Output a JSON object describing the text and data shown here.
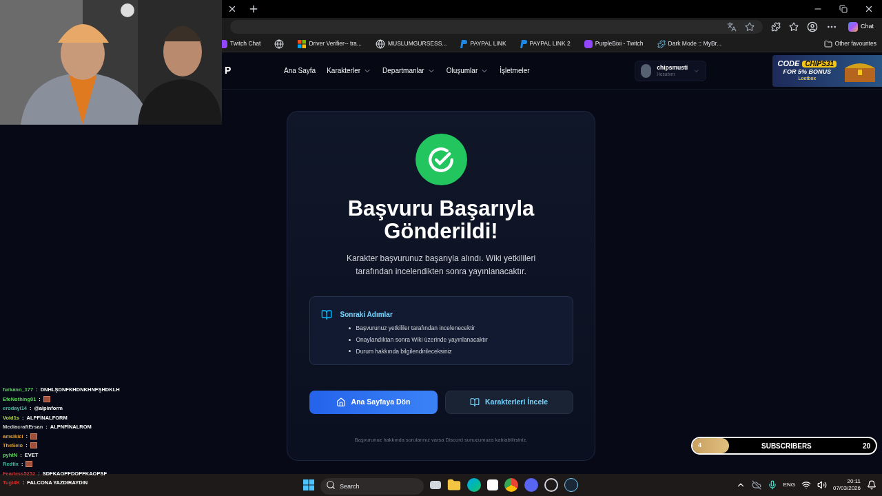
{
  "browser": {
    "chat_button": "Chat",
    "bookmarks": [
      {
        "kind": "labeled",
        "label": "Twitch Chat"
      },
      {
        "kind": "icon_only"
      },
      {
        "kind": "labeled",
        "label": "Driver Verifier-- tra..."
      },
      {
        "kind": "labeled",
        "label": "MUSLUMGURSESS..."
      },
      {
        "kind": "labeled",
        "label": "PAYPAL LINK"
      },
      {
        "kind": "labeled",
        "label": "PAYPAL LINK 2"
      },
      {
        "kind": "labeled",
        "label": "PurpleBixi - Twitch"
      },
      {
        "kind": "labeled",
        "label": "Dark Mode :: MyBr..."
      }
    ],
    "other_favourites": "Other favourites"
  },
  "site": {
    "logo": "P",
    "nav": [
      {
        "label": "Ana Sayfa",
        "dropdown": false
      },
      {
        "label": "Karakterler",
        "dropdown": true
      },
      {
        "label": "Departmanlar",
        "dropdown": true
      },
      {
        "label": "Oluşumlar",
        "dropdown": true
      },
      {
        "label": "İşletmeler",
        "dropdown": false
      }
    ],
    "user": {
      "name": "chipsmusti",
      "subtitle": "Hesabım"
    },
    "ad": {
      "code": "CODE",
      "promo": "CHIPS31",
      "bonus": "FOR 5% BONUS",
      "brand": "Lootbox"
    }
  },
  "card": {
    "title": "Başvuru Başarıyla Gönderildi!",
    "message": "Karakter başvurunuz başarıyla alındı. Wiki yetkilileri tarafından incelendikten sonra yayınlanacaktır.",
    "next_steps": {
      "title": "Sonraki Adımlar",
      "items": [
        "Başvurunuz yetkililer tarafından incelenecektir",
        "Onaylandıktan sonra Wiki üzerinde yayınlanacaktır",
        "Durum hakkında bilgilendirileceksiniz"
      ]
    },
    "buttons": [
      {
        "label": "Ana Sayfaya Dön",
        "kind": "primary"
      },
      {
        "label": "Karakterleri İncele",
        "kind": "secondary"
      }
    ],
    "footer": "Başvurunuz hakkında sorularınız varsa Discord sunucumuza katılabilirsiniz."
  },
  "chat": [
    {
      "user": "furkann_177",
      "sep": ":",
      "color": "#5fd35f",
      "message": "DNHLŞDNFKHDNKHNFŞHDKLH",
      "emote": false
    },
    {
      "user": "EfeNothing01",
      "sep": ":",
      "color": "#5fd35f",
      "emote": true
    },
    {
      "user": "erodayi14",
      "sep": ":",
      "color": "#3fbfa0",
      "message": "@alpinform",
      "emote": false
    },
    {
      "user": "Void1s",
      "sep": ":",
      "color": "#b5d94a",
      "message": "ALPFİNALFORM",
      "emote": false
    },
    {
      "user": "MediacraftErsan",
      "sep": ":",
      "color": "#d0d0d0",
      "message": "ALPNFİNALROM",
      "emote": false
    },
    {
      "user": "amsikici",
      "sep": ":",
      "color": "#e0a030",
      "emote": true
    },
    {
      "user": "TheSelo",
      "sep": ":",
      "color": "#e0a030",
      "emote": true
    },
    {
      "user": "pyhtN",
      "sep": ":",
      "color": "#5fd35f",
      "message": "EVET",
      "emote": false
    },
    {
      "user": "Redtix",
      "sep": ":",
      "color": "#3fbfa0",
      "emote": true
    },
    {
      "user": "Fearless5252",
      "sep": ":",
      "color": "#d03030",
      "message": "SDFKAOPFDOPFKAOPSF",
      "emote": false
    },
    {
      "user": "Tugi4K",
      "sep": ":",
      "color": "#d03030",
      "message": "FALCONA YAZDIRAYDIN",
      "emote": false
    }
  ],
  "subscribers": {
    "current": "4",
    "label": "SUBSCRIBERS",
    "goal": "20",
    "level": 0.2
  },
  "taskbar": {
    "search_placeholder": "Search",
    "language": "ENG",
    "time": "20:11",
    "date": "07/03/2026"
  }
}
